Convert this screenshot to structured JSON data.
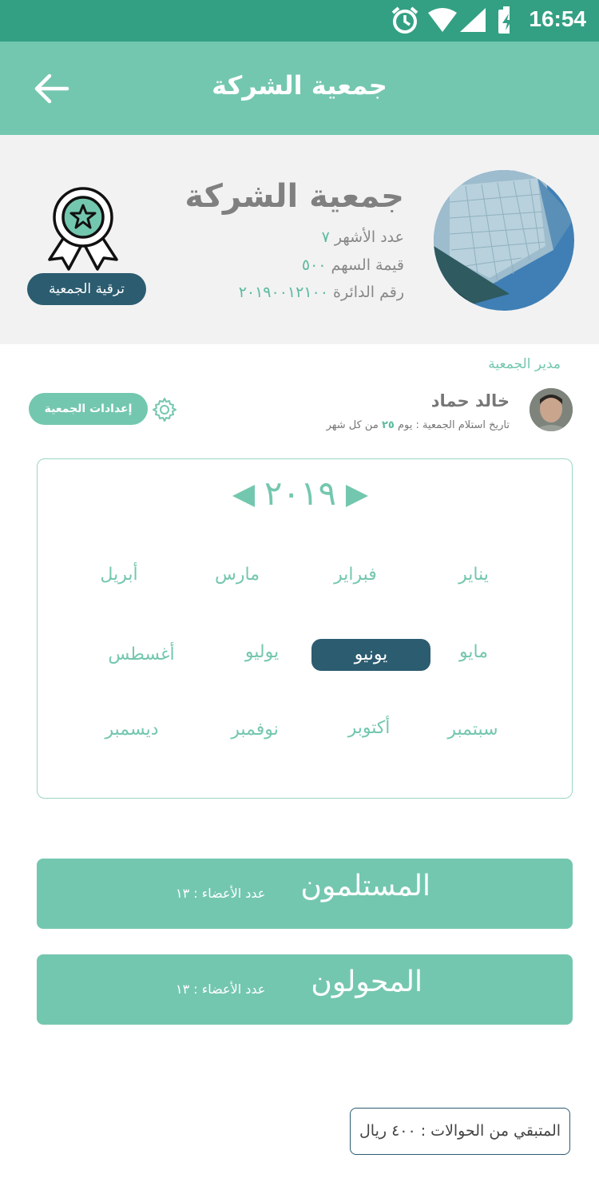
{
  "status_bar": {
    "time": "16:54",
    "icons": [
      "alarm-icon",
      "wifi-icon",
      "signal-icon",
      "battery-charging-icon"
    ]
  },
  "app_bar": {
    "title": "جمعية الشركة"
  },
  "header": {
    "company_name": "جمعية الشركة",
    "months_label": "عدد الأشهر",
    "months_value": "٧",
    "share_label": "قيمة السهم",
    "share_value": "٥٠٠",
    "circle_label": "رقم الدائرة",
    "circle_value": "٢٠١٩٠٠١٢١٠٠",
    "upgrade_label": "ترقية الجمعية"
  },
  "manager": {
    "section_label": "مدير الجمعية",
    "name": "خالد حماد",
    "receipt_prefix": "تاريخ استلام الجمعية : يوم",
    "receipt_day": "٢٥",
    "receipt_suffix": "من كل شهر",
    "settings_label": "إعدادات الجمعية"
  },
  "calendar": {
    "year": "٢٠١٩",
    "months": [
      {
        "label": "يناير"
      },
      {
        "label": "فبراير"
      },
      {
        "label": "مارس"
      },
      {
        "label": "أبريل"
      },
      {
        "label": "مايو"
      },
      {
        "label": "يونيو"
      },
      {
        "label": "يوليو"
      },
      {
        "label": "أغسطس"
      },
      {
        "label": "سبتمبر"
      },
      {
        "label": "أكتوبر"
      },
      {
        "label": "نوفمبر"
      },
      {
        "label": "ديسمبر"
      }
    ],
    "selected_month": "يونيو"
  },
  "groups": [
    {
      "title": "المستلمون",
      "count_label": "عدد الأعضاء : ١٣"
    },
    {
      "title": "المحولون",
      "count_label": "عدد الأعضاء : ١٣"
    }
  ],
  "remaining": {
    "label": "المتبقي من الحوالات : ٤٠٠ ريال"
  },
  "colors": {
    "primary": "#74c7af",
    "status": "#33a083",
    "dark": "#2c5c70"
  }
}
